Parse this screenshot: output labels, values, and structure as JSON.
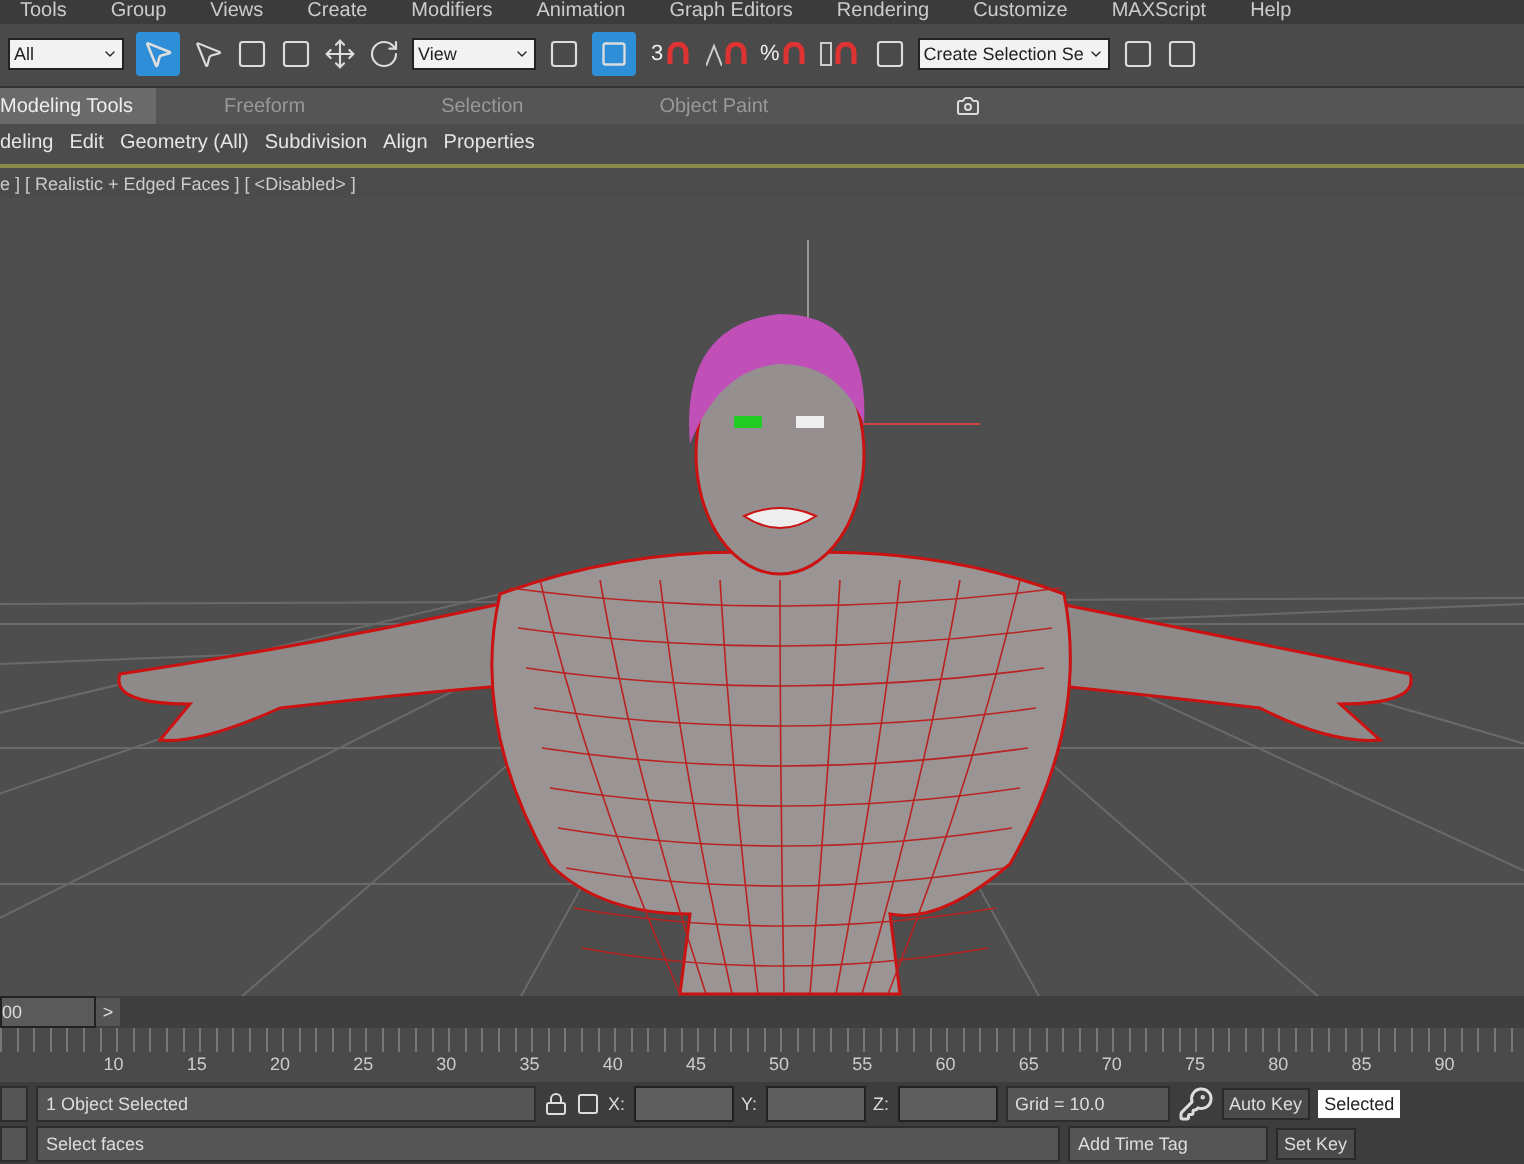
{
  "menu": [
    "Tools",
    "Group",
    "Views",
    "Create",
    "Modifiers",
    "Animation",
    "Graph Editors",
    "Rendering",
    "Customize",
    "MAXScript",
    "Help"
  ],
  "toolbar": {
    "filter": "All",
    "coordinate_system": "View",
    "named_selection": "Create Selection Se",
    "snaps": [
      {
        "kind": "dimension",
        "label": "3"
      },
      {
        "kind": "angle"
      },
      {
        "kind": "percent",
        "label": "%"
      },
      {
        "kind": "spinner"
      }
    ]
  },
  "ribbon_tabs": [
    {
      "label": "Modeling Tools",
      "selected": true
    },
    {
      "label": "Freeform",
      "selected": false
    },
    {
      "label": "Selection",
      "selected": false
    },
    {
      "label": "Object Paint",
      "selected": false
    }
  ],
  "ribbon_panels": [
    "deling",
    "Edit",
    "Geometry (All)",
    "Subdivision",
    "Align",
    "Properties"
  ],
  "viewport": {
    "label": "e ] [ Realistic + Edged Faces ] [ <Disabled> ]"
  },
  "time_slider": {
    "frame": "00",
    "next": ">"
  },
  "ruler": [
    "10",
    "15",
    "20",
    "25",
    "30",
    "35",
    "40",
    "45",
    "50",
    "55",
    "60",
    "65",
    "70",
    "75",
    "80",
    "85",
    "90"
  ],
  "status": {
    "selection": "1 Object Selected",
    "x_label": "X:",
    "y_label": "Y:",
    "z_label": "Z:",
    "grid": "Grid = 10.0",
    "auto_key": "Auto Key",
    "key_filter": "Selected",
    "set_key": "Set Key",
    "prompt": "Select faces",
    "time_tag": "Add Time Tag"
  }
}
